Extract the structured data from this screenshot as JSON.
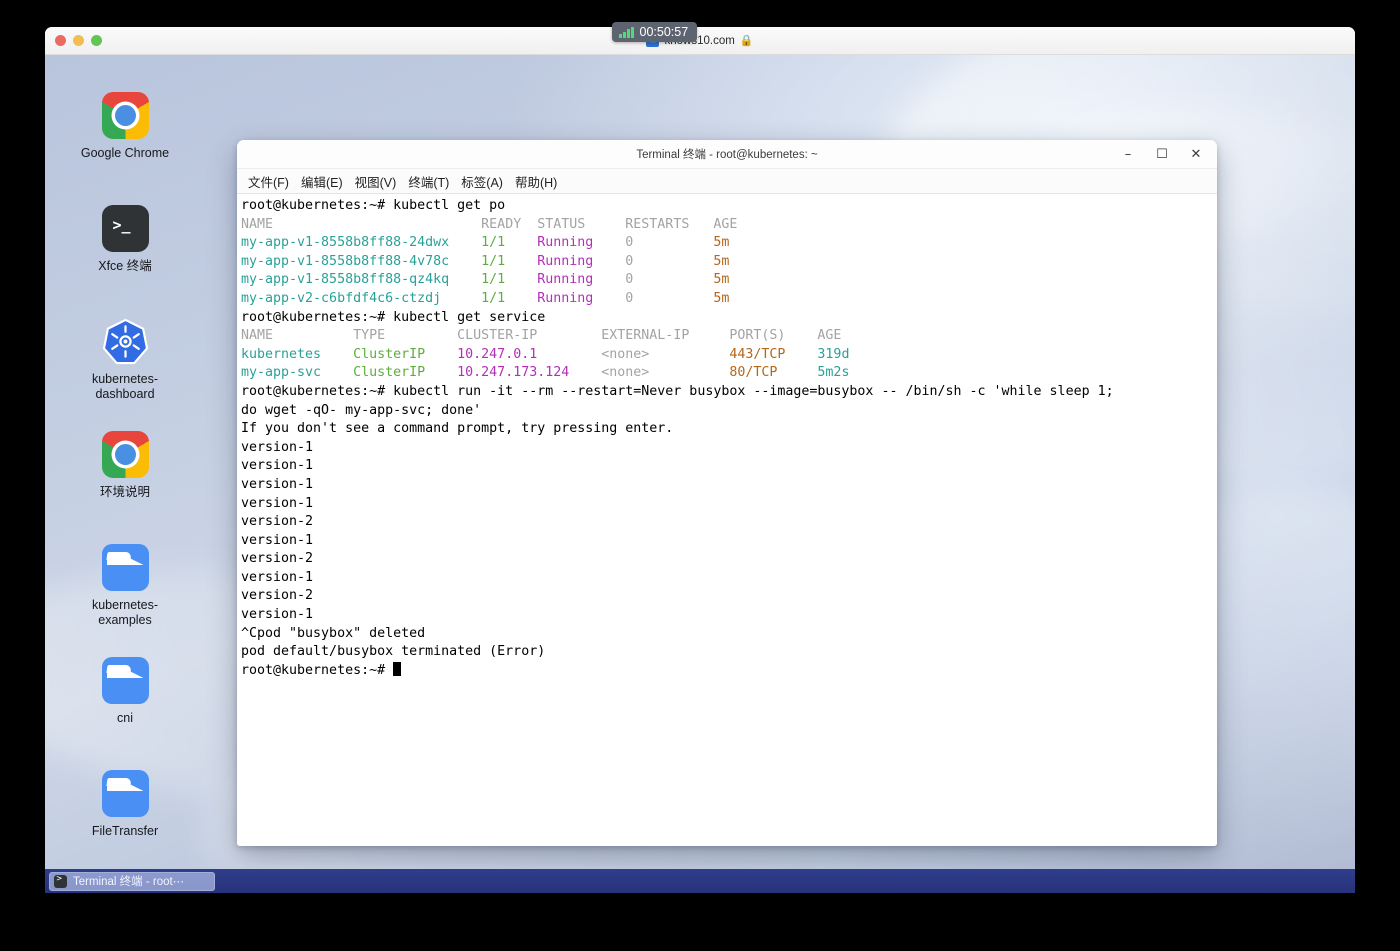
{
  "browser": {
    "url": "knows10.com",
    "url_icon": "site-shield-icon",
    "lock_icon": "ὑ2",
    "traffic_lights": [
      "close",
      "minimize",
      "maximize"
    ]
  },
  "timer": {
    "value": "00:50:57",
    "icon": "signal-bars-icon"
  },
  "desktop": {
    "icons": [
      {
        "label": "Google Chrome",
        "type": "chrome"
      },
      {
        "label": "Xfce 终端",
        "type": "terminal"
      },
      {
        "label": "kubernetes-dashboard",
        "type": "kubernetes"
      },
      {
        "label": "环境说明",
        "type": "chrome"
      },
      {
        "label": "kubernetes-examples",
        "type": "folder"
      },
      {
        "label": "cni",
        "type": "folder"
      },
      {
        "label": "FileTransfer",
        "type": "folder"
      }
    ]
  },
  "terminal": {
    "title": "Terminal 终端 - root@kubernetes: ~",
    "window_buttons": {
      "minimize": "–",
      "maximize": "☐",
      "close": "✕"
    },
    "menu": [
      "文件(F)",
      "编辑(E)",
      "视图(V)",
      "终端(T)",
      "标签(A)",
      "帮助(H)"
    ],
    "prompt": "root@kubernetes:~# ",
    "lines": [
      {
        "id": "cmd1",
        "kind": "prompt",
        "command": "kubectl get po"
      },
      {
        "id": "pod-head",
        "kind": "pod-header",
        "cols": {
          "name": "NAME                          ",
          "ready": "READY  ",
          "status": "STATUS     ",
          "restarts": "RESTARTS   ",
          "age": "AGE"
        }
      },
      {
        "id": "pod-1",
        "kind": "pod-row",
        "cols": {
          "name": "my-app-v1-8558b8ff88-24dwx    ",
          "ready": "1/1    ",
          "status": "Running    ",
          "restarts": "0          ",
          "age": "5m"
        }
      },
      {
        "id": "pod-2",
        "kind": "pod-row",
        "cols": {
          "name": "my-app-v1-8558b8ff88-4v78c    ",
          "ready": "1/1    ",
          "status": "Running    ",
          "restarts": "0          ",
          "age": "5m"
        }
      },
      {
        "id": "pod-3",
        "kind": "pod-row",
        "cols": {
          "name": "my-app-v1-8558b8ff88-qz4kq    ",
          "ready": "1/1    ",
          "status": "Running    ",
          "restarts": "0          ",
          "age": "5m"
        }
      },
      {
        "id": "pod-4",
        "kind": "pod-row",
        "cols": {
          "name": "my-app-v2-c6bfdf4c6-ctzdj     ",
          "ready": "1/1    ",
          "status": "Running    ",
          "restarts": "0          ",
          "age": "5m"
        }
      },
      {
        "id": "cmd2",
        "kind": "prompt",
        "command": "kubectl get service"
      },
      {
        "id": "svc-head",
        "kind": "svc-header",
        "cols": {
          "name": "NAME          ",
          "type": "TYPE         ",
          "cip": "CLUSTER-IP        ",
          "eip": "EXTERNAL-IP     ",
          "ports": "PORT(S)    ",
          "age": "AGE"
        }
      },
      {
        "id": "svc-1",
        "kind": "svc-row",
        "cols": {
          "name": "kubernetes    ",
          "type": "ClusterIP    ",
          "cip": "10.247.0.1        ",
          "eip": "<none>          ",
          "ports": "443/TCP    ",
          "age": "319d"
        }
      },
      {
        "id": "svc-2",
        "kind": "svc-row",
        "cols": {
          "name": "my-app-svc    ",
          "type": "ClusterIP    ",
          "cip": "10.247.173.124    ",
          "eip": "<none>          ",
          "ports": "80/TCP     ",
          "age": "5m2s"
        }
      },
      {
        "id": "cmd3",
        "kind": "prompt",
        "command": "kubectl run -it --rm --restart=Never busybox --image=busybox -- /bin/sh -c 'while sleep 1;"
      },
      {
        "id": "cmd3-wrap",
        "kind": "plain",
        "text": "do wget -qO- my-app-svc; done'"
      },
      {
        "id": "hint",
        "kind": "plain",
        "text": "If you don't see a command prompt, try pressing enter."
      },
      {
        "id": "out-1",
        "kind": "plain",
        "text": "version-1"
      },
      {
        "id": "out-2",
        "kind": "plain",
        "text": "version-1"
      },
      {
        "id": "out-3",
        "kind": "plain",
        "text": "version-1"
      },
      {
        "id": "out-4",
        "kind": "plain",
        "text": "version-1"
      },
      {
        "id": "out-5",
        "kind": "plain",
        "text": "version-2"
      },
      {
        "id": "out-6",
        "kind": "plain",
        "text": "version-1"
      },
      {
        "id": "out-7",
        "kind": "plain",
        "text": "version-2"
      },
      {
        "id": "out-8",
        "kind": "plain",
        "text": "version-1"
      },
      {
        "id": "out-9",
        "kind": "plain",
        "text": "version-2"
      },
      {
        "id": "out-10",
        "kind": "plain",
        "text": "version-1"
      },
      {
        "id": "interrupt",
        "kind": "plain",
        "text": "^Cpod \"busybox\" deleted"
      },
      {
        "id": "terminated",
        "kind": "plain",
        "text": "pod default/busybox terminated (Error)"
      },
      {
        "id": "final-prompt",
        "kind": "prompt-cursor",
        "command": ""
      }
    ]
  },
  "taskbar": {
    "items": [
      {
        "label": "Terminal 终端 - root⋯",
        "icon": "terminal-icon"
      }
    ]
  },
  "colors": {
    "pod_name": "#2aa198",
    "ready": "#5fad3f",
    "status": "#b32fb8",
    "age": "#b5661c",
    "cluster_ip": "#b32fb8",
    "service_age": "#2aa198",
    "header": "#a3a3a3",
    "taskbar": "#2f3d8c"
  }
}
